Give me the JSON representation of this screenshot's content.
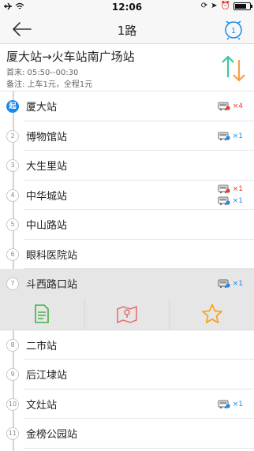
{
  "status_bar": {
    "time": "12:06",
    "icons": [
      "airplane-icon",
      "wifi-icon",
      "lock-rotation-icon",
      "location-icon",
      "alarm-icon",
      "battery-icon"
    ],
    "battery_level": 0.8
  },
  "nav": {
    "title": "1路",
    "back_icon": "back-arrow-icon",
    "alarm_icon": "alarm-clock-icon",
    "alarm_badge": "1"
  },
  "route": {
    "title": "厦大站→火车站南广场站",
    "time_label": "首末: 05:50--00:30",
    "note_label": "备注: 上车1元，全程1元",
    "switch_icon": "switch-direction-icon"
  },
  "colors": {
    "accent_blue": "#1e88e5",
    "bus_red": "#e53935",
    "switch_green": "#3cc7a6",
    "switch_orange": "#f5a04a",
    "action_green": "#43b04a",
    "action_red": "#e46c6c",
    "action_orange": "#f5a623"
  },
  "stations": [
    {
      "index": "起",
      "name": "厦大站",
      "buses": [
        {
          "type": "arriving",
          "count": "×4"
        }
      ]
    },
    {
      "index": "2",
      "name": "博物馆站",
      "buses": [
        {
          "type": "coming",
          "count": "×1"
        }
      ]
    },
    {
      "index": "3",
      "name": "大生里站",
      "buses": []
    },
    {
      "index": "4",
      "name": "中华城站",
      "buses": [
        {
          "type": "arriving",
          "count": "×1"
        },
        {
          "type": "coming",
          "count": "×1"
        }
      ]
    },
    {
      "index": "5",
      "name": "中山路站",
      "buses": []
    },
    {
      "index": "6",
      "name": "眼科医院站",
      "buses": []
    },
    {
      "index": "7",
      "name": "斗西路口站",
      "buses": [
        {
          "type": "coming",
          "count": "×1"
        }
      ]
    },
    {
      "index": "8",
      "name": "二市站",
      "buses": []
    },
    {
      "index": "9",
      "name": "后江埭站",
      "buses": []
    },
    {
      "index": "10",
      "name": "文灶站",
      "buses": [
        {
          "type": "coming",
          "count": "×1"
        }
      ]
    },
    {
      "index": "11",
      "name": "金榜公园站",
      "buses": []
    }
  ],
  "actions": [
    {
      "icon": "document-icon"
    },
    {
      "icon": "map-pin-icon"
    },
    {
      "icon": "star-icon"
    }
  ]
}
